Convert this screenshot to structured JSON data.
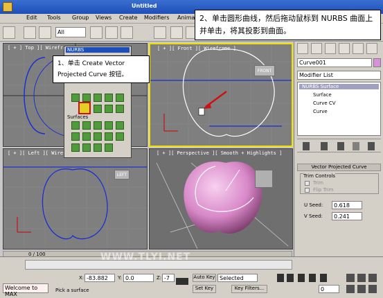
{
  "title": "Untitled",
  "menu": [
    "Edit",
    "Tools",
    "Group",
    "Views",
    "Create",
    "Modifiers",
    "Animat"
  ],
  "toolbar": {
    "selection_filter": "All"
  },
  "callouts": {
    "step1": "1、单击 Create Vector Projected Curve 按钮。",
    "step2": "2、单击圆形曲线，然后拖动鼠标到 NURBS 曲面上并单击，将其投影到曲面。"
  },
  "viewports": {
    "top": "[ + ] Top ][ Wirefram",
    "front": "[ + ][ Front ][ Wireframe ]",
    "left": "[ + ][ Left ][ Wirefram",
    "perspective": "[ + ][ Perspective ][ Smooth + Highlights ]",
    "front_cube": "FRONT",
    "left_cube": "LEFT"
  },
  "nurbs_popup": {
    "title": "NURBS",
    "surfaces_label": "Surfaces"
  },
  "command_panel": {
    "object_name": "Curve001",
    "modifier_list": "Modifier List",
    "stack": [
      "NURBS Surface",
      "Surface",
      "Curve CV",
      "Curve"
    ],
    "rollout_title": "Vector Projected Curve",
    "trim_controls": "Trim Controls",
    "trim": "Trim",
    "flip_trim": "Flip Trim",
    "u_seed_label": "U Seed:",
    "u_seed": "0.618",
    "v_seed_label": "V Seed:",
    "v_seed": "0.241"
  },
  "status": {
    "frame_counter": "0 / 100",
    "welcome": "Welcome to MAX",
    "prompt": "Pick a surface",
    "x_label": "X:",
    "x_value": "-83.882",
    "y_label": "Y:",
    "y_value": "0.0",
    "z_label": "Z:",
    "z_value": "-7",
    "auto_key": "Auto Key",
    "set_key": "Set Key",
    "selected": "Selected",
    "key_filters": "Key Filters...",
    "frame": "0",
    "watermark": "WWW.TLYI.NET"
  },
  "colors": {
    "curve_blue": "#1a2fcf",
    "nurbs_pink": "#d888c8",
    "highlight_yellow": "#f2e000",
    "arrow_red": "#d01010"
  }
}
